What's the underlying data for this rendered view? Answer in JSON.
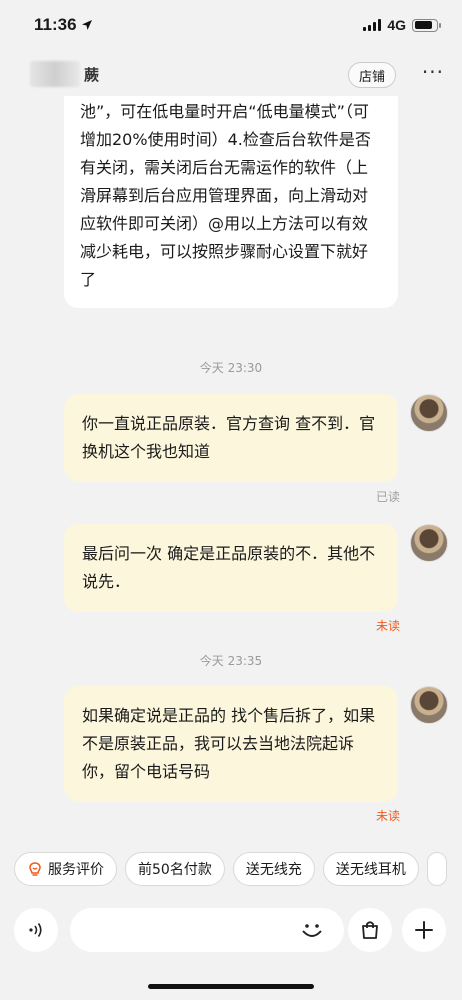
{
  "status_bar": {
    "time": "11:36",
    "network": "4G",
    "battery_level": 0.85
  },
  "header": {
    "title": "蕨",
    "store_label": "店铺",
    "more_label": "···"
  },
  "messages": [
    {
      "type": "incoming",
      "text": "池”，可在低电量时开启“低电量模式”（可增加20%使用时间）4.检查后台软件是否有关闭，需关闭后台无需运作的软件（上滑屏幕到后台应用管理界面，向上滑动对应软件即可关闭）@用以上方法可以有效减少耗电，可以按照步骤耐心设置下就好了"
    },
    {
      "type": "time",
      "text": "今天 23:30"
    },
    {
      "type": "outgoing",
      "text": "你一直说正品原装．官方查询 查不到．官换机这个我也知道",
      "receipt": "已读"
    },
    {
      "type": "outgoing",
      "text": "最后问一次 确定是正品原装的不．其他不说先．",
      "receipt": "未读"
    },
    {
      "type": "time",
      "text": "今天 23:35"
    },
    {
      "type": "outgoing",
      "text": "如果确定说是正品的 找个售后拆了，如果不是原装正品，我可以去当地法院起诉你，留个电话号码",
      "receipt": "未读"
    }
  ],
  "quick_replies": [
    "服务评价",
    "前50名付款",
    "送无线充",
    "送无线耳机"
  ],
  "input": {
    "placeholder": ""
  },
  "colors": {
    "accent": "#f05a1a",
    "outgoing_bubble": "#fbf6dc",
    "incoming_bubble": "#ffffff",
    "background": "#f2f2f2"
  }
}
